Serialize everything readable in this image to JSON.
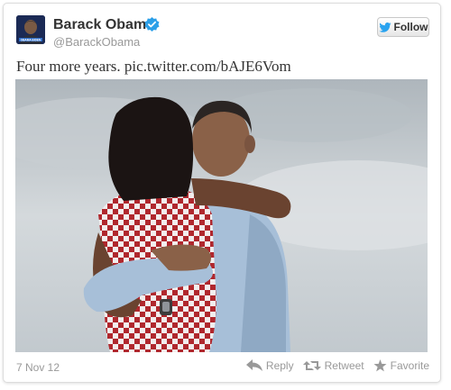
{
  "tweet": {
    "author_name": "Barack Obama",
    "handle": "@BarackObama",
    "text": "Four more years.",
    "link": "pic.twitter.com/bAJE6Vom",
    "date": "7 Nov 12"
  },
  "avatar": {
    "caption": "OBAMA BIDEN"
  },
  "follow_button": {
    "label": "Follow"
  },
  "actions": {
    "reply": "Reply",
    "retweet": "Retweet",
    "favorite": "Favorite"
  },
  "colors": {
    "twitter_blue": "#2aa3ef",
    "verified_blue": "#2b9fe8",
    "text_gray": "#999999"
  },
  "icons": [
    "verified-badge-icon",
    "twitter-bird-icon",
    "reply-icon",
    "retweet-icon",
    "favorite-star-icon"
  ]
}
